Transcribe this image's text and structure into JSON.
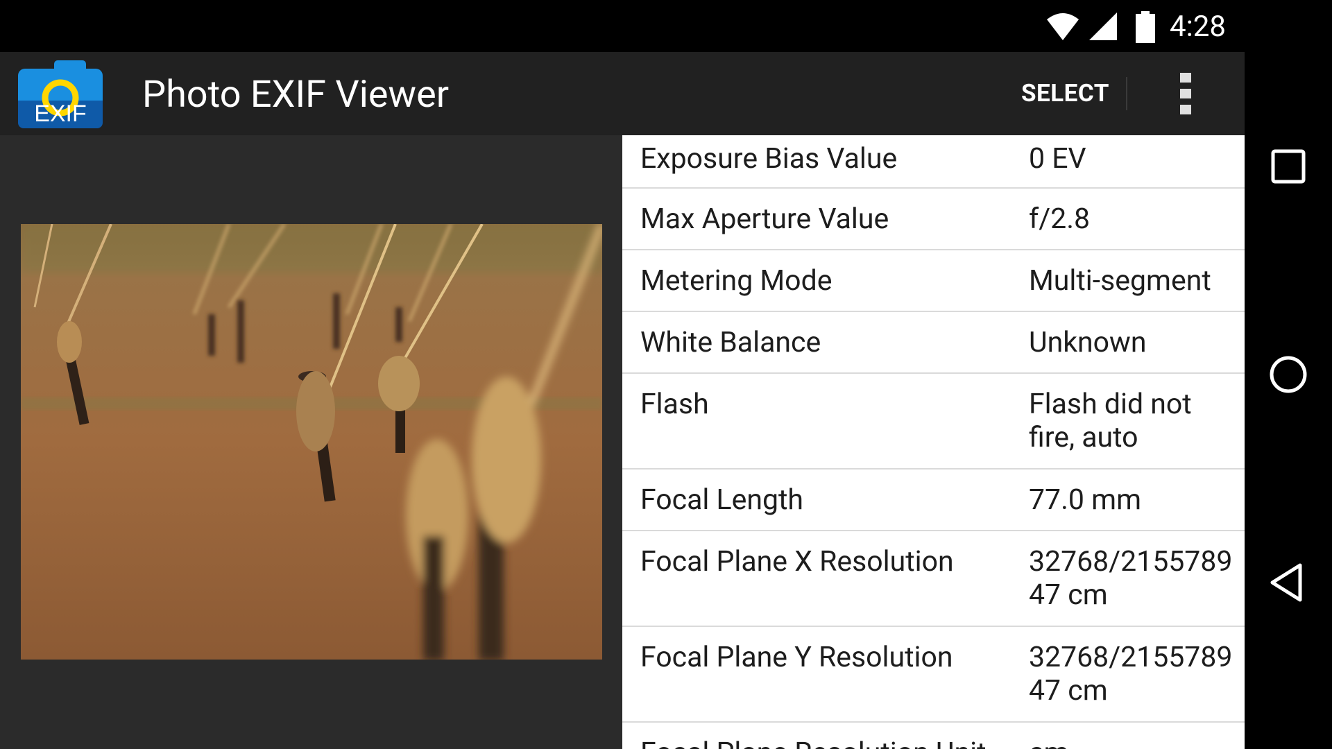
{
  "status_bar": {
    "time": "4:28"
  },
  "app_bar": {
    "logo_text": "EXIF",
    "title": "Photo EXIF Viewer",
    "select_label": "SELECT"
  },
  "photo": {
    "alt": "Rope-tied wooden tent stakes in reddish-brown soil"
  },
  "exif": {
    "rows": [
      {
        "label": "Exposure Bias Value",
        "value": "0 EV"
      },
      {
        "label": "Max Aperture Value",
        "value": "f/2.8"
      },
      {
        "label": "Metering Mode",
        "value": "Multi-segment"
      },
      {
        "label": "White Balance",
        "value": "Unknown"
      },
      {
        "label": "Flash",
        "value": "Flash did not fire, auto"
      },
      {
        "label": "Focal Length",
        "value": "77.0 mm"
      },
      {
        "label": "Focal Plane X Resolution",
        "value": "32768/2155789 47 cm"
      },
      {
        "label": "Focal Plane Y Resolution",
        "value": "32768/2155789 47 cm"
      },
      {
        "label": "Focal Plane Resolution Unit",
        "value": "cm"
      }
    ]
  },
  "colors": {
    "status_bar": "#000000",
    "app_bar": "#212121",
    "content_bg": "#2b2b2b",
    "logo_blue": "#1a8fe0",
    "logo_yellow": "#ffd600",
    "row_divider": "#dadada"
  },
  "icons": {
    "status": [
      "wifi-icon",
      "cell-signal-icon",
      "battery-icon"
    ],
    "action": [
      "overflow-menu-icon"
    ],
    "nav": [
      "recent-apps-icon",
      "home-icon",
      "back-icon"
    ]
  }
}
